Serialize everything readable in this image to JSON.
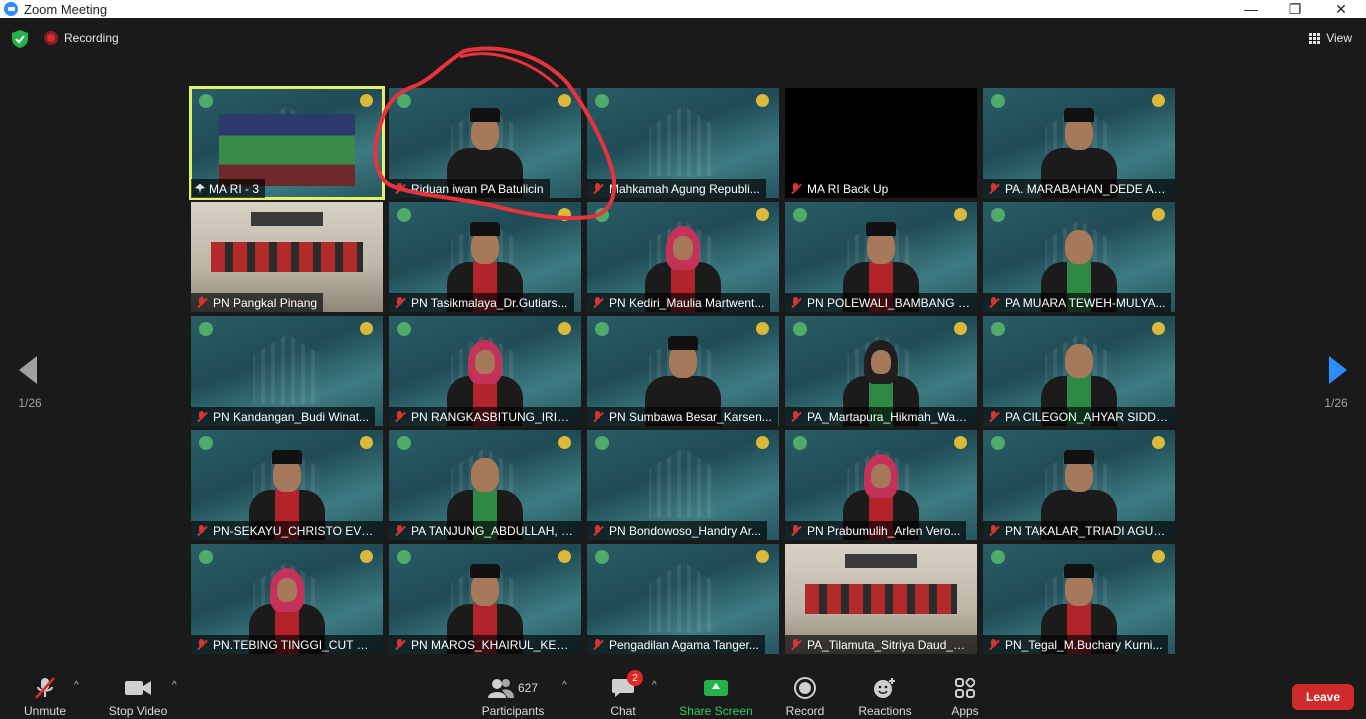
{
  "window": {
    "title": "Zoom Meeting",
    "minimize": "—",
    "maximize": "❐",
    "close": "✕"
  },
  "meeting": {
    "recording_label": "Recording",
    "view_label": "View"
  },
  "pagination": {
    "left": "1/26",
    "right": "1/26"
  },
  "tiles": [
    "MA RI - 3",
    "Riduan iwan PA Batulicin",
    "Mahkamah Agung Republi...",
    "MA RI Back Up",
    "PA. MARABAHAN_DEDE AN...",
    "PN Pangkal Pinang",
    "PN Tasikmalaya_Dr.Gutiars...",
    "PN Kediri_Maulia Martwent...",
    "PN POLEWALI_BAMBANG S...",
    "PA MUARA TEWEH-MULYA...",
    "PN Kandangan_Budi Winat...",
    "PN RANGKASBITUNG_IRIAT...",
    "PN Sumbawa Besar_Karsen...",
    "PA_Martapura_Hikmah_Wak...",
    "PA CILEGON_AHYAR SIDDI...",
    "PN-SEKAYU_CHRISTO EVER...",
    "PA TANJUNG_ABDULLAH, S...",
    "PN Bondowoso_Handry Ar...",
    "PN Prabumulih_Arlen Vero...",
    "PN TAKALAR_TRIADI AGUS ...",
    "PN.TEBING TINGGI_CUT CA...",
    "PN MAROS_KHAIRUL_KETUA",
    "Pengadilan Agama Tanger...",
    "PA_Tilamuta_Sitriya Daud_K...",
    "PN_Tegal_M.Buchary Kurni..."
  ],
  "toolbar": {
    "unmute": "Unmute",
    "stop_video": "Stop Video",
    "participants": "Participants",
    "participant_count": "627",
    "chat": "Chat",
    "chat_badge": "2",
    "share_screen": "Share Screen",
    "record": "Record",
    "reactions": "Reactions",
    "apps": "Apps",
    "leave": "Leave"
  },
  "colors": {
    "active_speaker": "#e3f06a",
    "annotation": "#e8323c",
    "share": "#23b34a",
    "leave": "#d02b2b"
  }
}
